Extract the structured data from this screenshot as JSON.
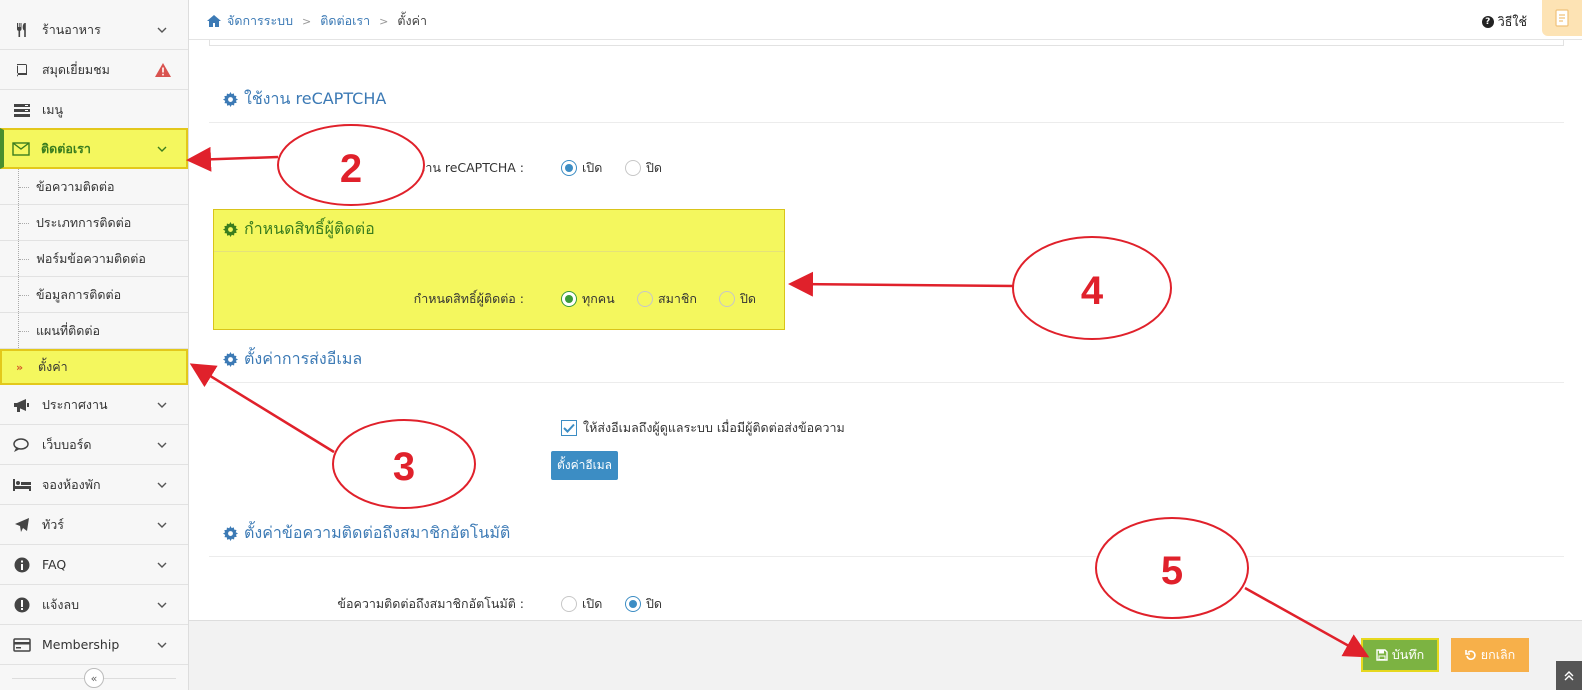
{
  "sidebar": {
    "items": [
      {
        "label": "ร้านอาหาร",
        "icon": "utensils-icon"
      },
      {
        "label": "สมุดเยี่ยมชม",
        "icon": "book-icon",
        "badge": "warning-icon"
      },
      {
        "label": "เมนู",
        "icon": "server-menu-icon"
      },
      {
        "label": "ติดต่อเรา",
        "icon": "envelope-icon"
      },
      {
        "label": "ประกาศงาน",
        "icon": "megaphone-icon"
      },
      {
        "label": "เว็บบอร์ด",
        "icon": "comments-icon"
      },
      {
        "label": "จองห้องพัก",
        "icon": "bed-icon"
      },
      {
        "label": "ทัวร์",
        "icon": "plane-icon"
      },
      {
        "label": "FAQ",
        "icon": "info-icon"
      },
      {
        "label": "แจ้งลบ",
        "icon": "exclamation-icon"
      },
      {
        "label": "Membership",
        "icon": "credit-card-icon"
      }
    ],
    "sub_items": [
      {
        "label": "ข้อความติดต่อ"
      },
      {
        "label": "ประเภทการติดต่อ"
      },
      {
        "label": "ฟอร์มข้อความติดต่อ"
      },
      {
        "label": "ข้อมูลการติดต่อ"
      },
      {
        "label": "แผนที่ติดต่อ"
      },
      {
        "label": "ตั้งค่า",
        "prefix": "»"
      }
    ],
    "collapse": "«"
  },
  "header": {
    "breadcrumb": [
      "จัดการระบบ",
      "ติดต่อเรา",
      "ตั้งค่า"
    ],
    "help_label": "วิธีใช้"
  },
  "sections": {
    "recaptcha": {
      "title": "ใช้งาน reCAPTCHA",
      "label": "ใช้งาน reCAPTCHA :",
      "options": [
        "เปิด",
        "ปิด"
      ],
      "selected": "เปิด"
    },
    "permission": {
      "title": "กำหนดสิทธิ์ผู้ติดต่อ",
      "label": "กำหนดสิทธิ์ผู้ติดต่อ :",
      "options": [
        "ทุกคน",
        "สมาชิก",
        "ปิด"
      ],
      "selected": "ทุกคน"
    },
    "email": {
      "title": "ตั้งค่าการส่งอีเมล",
      "checkbox_label": "ให้ส่งอีเมลถึงผู้ดูแลระบบ เมื่อมีผู้ติดต่อส่งข้อความ",
      "checked": true,
      "button_label": "ตั้งค่าอีเมล"
    },
    "auto_message": {
      "title": "ตั้งค่าข้อความติดต่อถึงสมาชิกอัตโนมัติ",
      "label": "ข้อความติดต่อถึงสมาชิกอัตโนมัติ :",
      "options": [
        "เปิด",
        "ปิด"
      ],
      "selected": "ปิด"
    }
  },
  "footer": {
    "save_label": "บันทึก",
    "cancel_label": "ยกเลิก"
  },
  "annotations": {
    "markers": [
      "2",
      "3",
      "4",
      "5"
    ],
    "color": "#e0212b"
  },
  "colors": {
    "accent_blue": "#3c7ab5",
    "highlight_yellow": "#f4f75e",
    "save_green": "#7cb342",
    "cancel_orange": "#f7b04a"
  }
}
